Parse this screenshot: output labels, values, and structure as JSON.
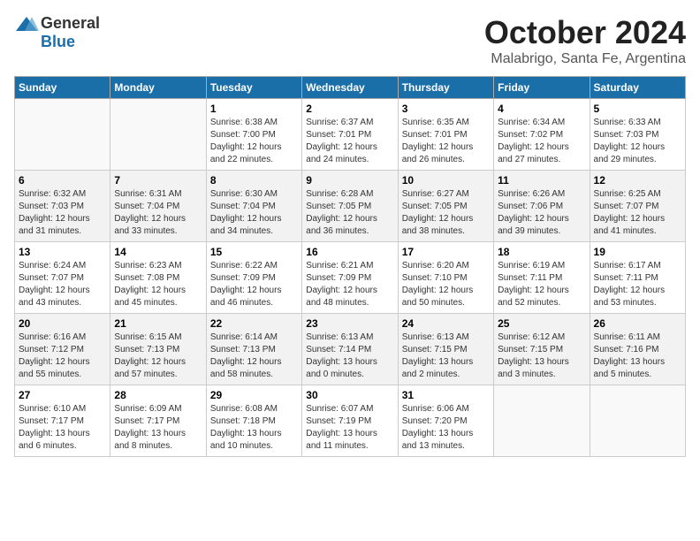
{
  "header": {
    "logo_general": "General",
    "logo_blue": "Blue",
    "month_title": "October 2024",
    "location": "Malabrigo, Santa Fe, Argentina"
  },
  "weekdays": [
    "Sunday",
    "Monday",
    "Tuesday",
    "Wednesday",
    "Thursday",
    "Friday",
    "Saturday"
  ],
  "weeks": [
    [
      {
        "day": "",
        "sunrise": "",
        "sunset": "",
        "daylight": ""
      },
      {
        "day": "",
        "sunrise": "",
        "sunset": "",
        "daylight": ""
      },
      {
        "day": "1",
        "sunrise": "Sunrise: 6:38 AM",
        "sunset": "Sunset: 7:00 PM",
        "daylight": "Daylight: 12 hours and 22 minutes."
      },
      {
        "day": "2",
        "sunrise": "Sunrise: 6:37 AM",
        "sunset": "Sunset: 7:01 PM",
        "daylight": "Daylight: 12 hours and 24 minutes."
      },
      {
        "day": "3",
        "sunrise": "Sunrise: 6:35 AM",
        "sunset": "Sunset: 7:01 PM",
        "daylight": "Daylight: 12 hours and 26 minutes."
      },
      {
        "day": "4",
        "sunrise": "Sunrise: 6:34 AM",
        "sunset": "Sunset: 7:02 PM",
        "daylight": "Daylight: 12 hours and 27 minutes."
      },
      {
        "day": "5",
        "sunrise": "Sunrise: 6:33 AM",
        "sunset": "Sunset: 7:03 PM",
        "daylight": "Daylight: 12 hours and 29 minutes."
      }
    ],
    [
      {
        "day": "6",
        "sunrise": "Sunrise: 6:32 AM",
        "sunset": "Sunset: 7:03 PM",
        "daylight": "Daylight: 12 hours and 31 minutes."
      },
      {
        "day": "7",
        "sunrise": "Sunrise: 6:31 AM",
        "sunset": "Sunset: 7:04 PM",
        "daylight": "Daylight: 12 hours and 33 minutes."
      },
      {
        "day": "8",
        "sunrise": "Sunrise: 6:30 AM",
        "sunset": "Sunset: 7:04 PM",
        "daylight": "Daylight: 12 hours and 34 minutes."
      },
      {
        "day": "9",
        "sunrise": "Sunrise: 6:28 AM",
        "sunset": "Sunset: 7:05 PM",
        "daylight": "Daylight: 12 hours and 36 minutes."
      },
      {
        "day": "10",
        "sunrise": "Sunrise: 6:27 AM",
        "sunset": "Sunset: 7:05 PM",
        "daylight": "Daylight: 12 hours and 38 minutes."
      },
      {
        "day": "11",
        "sunrise": "Sunrise: 6:26 AM",
        "sunset": "Sunset: 7:06 PM",
        "daylight": "Daylight: 12 hours and 39 minutes."
      },
      {
        "day": "12",
        "sunrise": "Sunrise: 6:25 AM",
        "sunset": "Sunset: 7:07 PM",
        "daylight": "Daylight: 12 hours and 41 minutes."
      }
    ],
    [
      {
        "day": "13",
        "sunrise": "Sunrise: 6:24 AM",
        "sunset": "Sunset: 7:07 PM",
        "daylight": "Daylight: 12 hours and 43 minutes."
      },
      {
        "day": "14",
        "sunrise": "Sunrise: 6:23 AM",
        "sunset": "Sunset: 7:08 PM",
        "daylight": "Daylight: 12 hours and 45 minutes."
      },
      {
        "day": "15",
        "sunrise": "Sunrise: 6:22 AM",
        "sunset": "Sunset: 7:09 PM",
        "daylight": "Daylight: 12 hours and 46 minutes."
      },
      {
        "day": "16",
        "sunrise": "Sunrise: 6:21 AM",
        "sunset": "Sunset: 7:09 PM",
        "daylight": "Daylight: 12 hours and 48 minutes."
      },
      {
        "day": "17",
        "sunrise": "Sunrise: 6:20 AM",
        "sunset": "Sunset: 7:10 PM",
        "daylight": "Daylight: 12 hours and 50 minutes."
      },
      {
        "day": "18",
        "sunrise": "Sunrise: 6:19 AM",
        "sunset": "Sunset: 7:11 PM",
        "daylight": "Daylight: 12 hours and 52 minutes."
      },
      {
        "day": "19",
        "sunrise": "Sunrise: 6:17 AM",
        "sunset": "Sunset: 7:11 PM",
        "daylight": "Daylight: 12 hours and 53 minutes."
      }
    ],
    [
      {
        "day": "20",
        "sunrise": "Sunrise: 6:16 AM",
        "sunset": "Sunset: 7:12 PM",
        "daylight": "Daylight: 12 hours and 55 minutes."
      },
      {
        "day": "21",
        "sunrise": "Sunrise: 6:15 AM",
        "sunset": "Sunset: 7:13 PM",
        "daylight": "Daylight: 12 hours and 57 minutes."
      },
      {
        "day": "22",
        "sunrise": "Sunrise: 6:14 AM",
        "sunset": "Sunset: 7:13 PM",
        "daylight": "Daylight: 12 hours and 58 minutes."
      },
      {
        "day": "23",
        "sunrise": "Sunrise: 6:13 AM",
        "sunset": "Sunset: 7:14 PM",
        "daylight": "Daylight: 13 hours and 0 minutes."
      },
      {
        "day": "24",
        "sunrise": "Sunrise: 6:13 AM",
        "sunset": "Sunset: 7:15 PM",
        "daylight": "Daylight: 13 hours and 2 minutes."
      },
      {
        "day": "25",
        "sunrise": "Sunrise: 6:12 AM",
        "sunset": "Sunset: 7:15 PM",
        "daylight": "Daylight: 13 hours and 3 minutes."
      },
      {
        "day": "26",
        "sunrise": "Sunrise: 6:11 AM",
        "sunset": "Sunset: 7:16 PM",
        "daylight": "Daylight: 13 hours and 5 minutes."
      }
    ],
    [
      {
        "day": "27",
        "sunrise": "Sunrise: 6:10 AM",
        "sunset": "Sunset: 7:17 PM",
        "daylight": "Daylight: 13 hours and 6 minutes."
      },
      {
        "day": "28",
        "sunrise": "Sunrise: 6:09 AM",
        "sunset": "Sunset: 7:17 PM",
        "daylight": "Daylight: 13 hours and 8 minutes."
      },
      {
        "day": "29",
        "sunrise": "Sunrise: 6:08 AM",
        "sunset": "Sunset: 7:18 PM",
        "daylight": "Daylight: 13 hours and 10 minutes."
      },
      {
        "day": "30",
        "sunrise": "Sunrise: 6:07 AM",
        "sunset": "Sunset: 7:19 PM",
        "daylight": "Daylight: 13 hours and 11 minutes."
      },
      {
        "day": "31",
        "sunrise": "Sunrise: 6:06 AM",
        "sunset": "Sunset: 7:20 PM",
        "daylight": "Daylight: 13 hours and 13 minutes."
      },
      {
        "day": "",
        "sunrise": "",
        "sunset": "",
        "daylight": ""
      },
      {
        "day": "",
        "sunrise": "",
        "sunset": "",
        "daylight": ""
      }
    ]
  ]
}
